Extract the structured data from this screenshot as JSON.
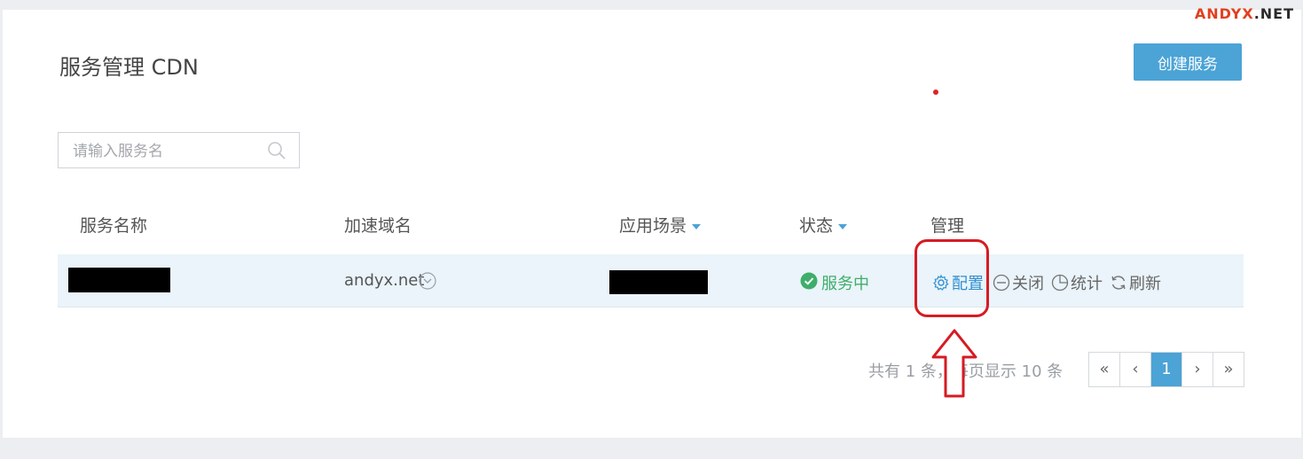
{
  "watermark": {
    "part1": "ANDYX",
    "part2": ".NET"
  },
  "header": {
    "title": "服务管理 CDN",
    "create_button": "创建服务"
  },
  "search": {
    "placeholder": "请输入服务名"
  },
  "table": {
    "columns": [
      "服务名称",
      "加速域名",
      "应用场景",
      "状态",
      "管理"
    ],
    "rows": [
      {
        "name": "",
        "domain": "andyx.net",
        "scenario": "",
        "status": "服务中",
        "actions": [
          "配置",
          "关闭",
          "统计",
          "刷新"
        ]
      }
    ]
  },
  "pagination": {
    "summary": "共有 1 条，每页显示 10 条",
    "buttons": [
      "«",
      "‹",
      "1",
      "›",
      "»"
    ],
    "current": "1"
  },
  "colors": {
    "accent": "#4ba3d6",
    "status_ok": "#3fae6a",
    "annotation": "#d61b23"
  }
}
